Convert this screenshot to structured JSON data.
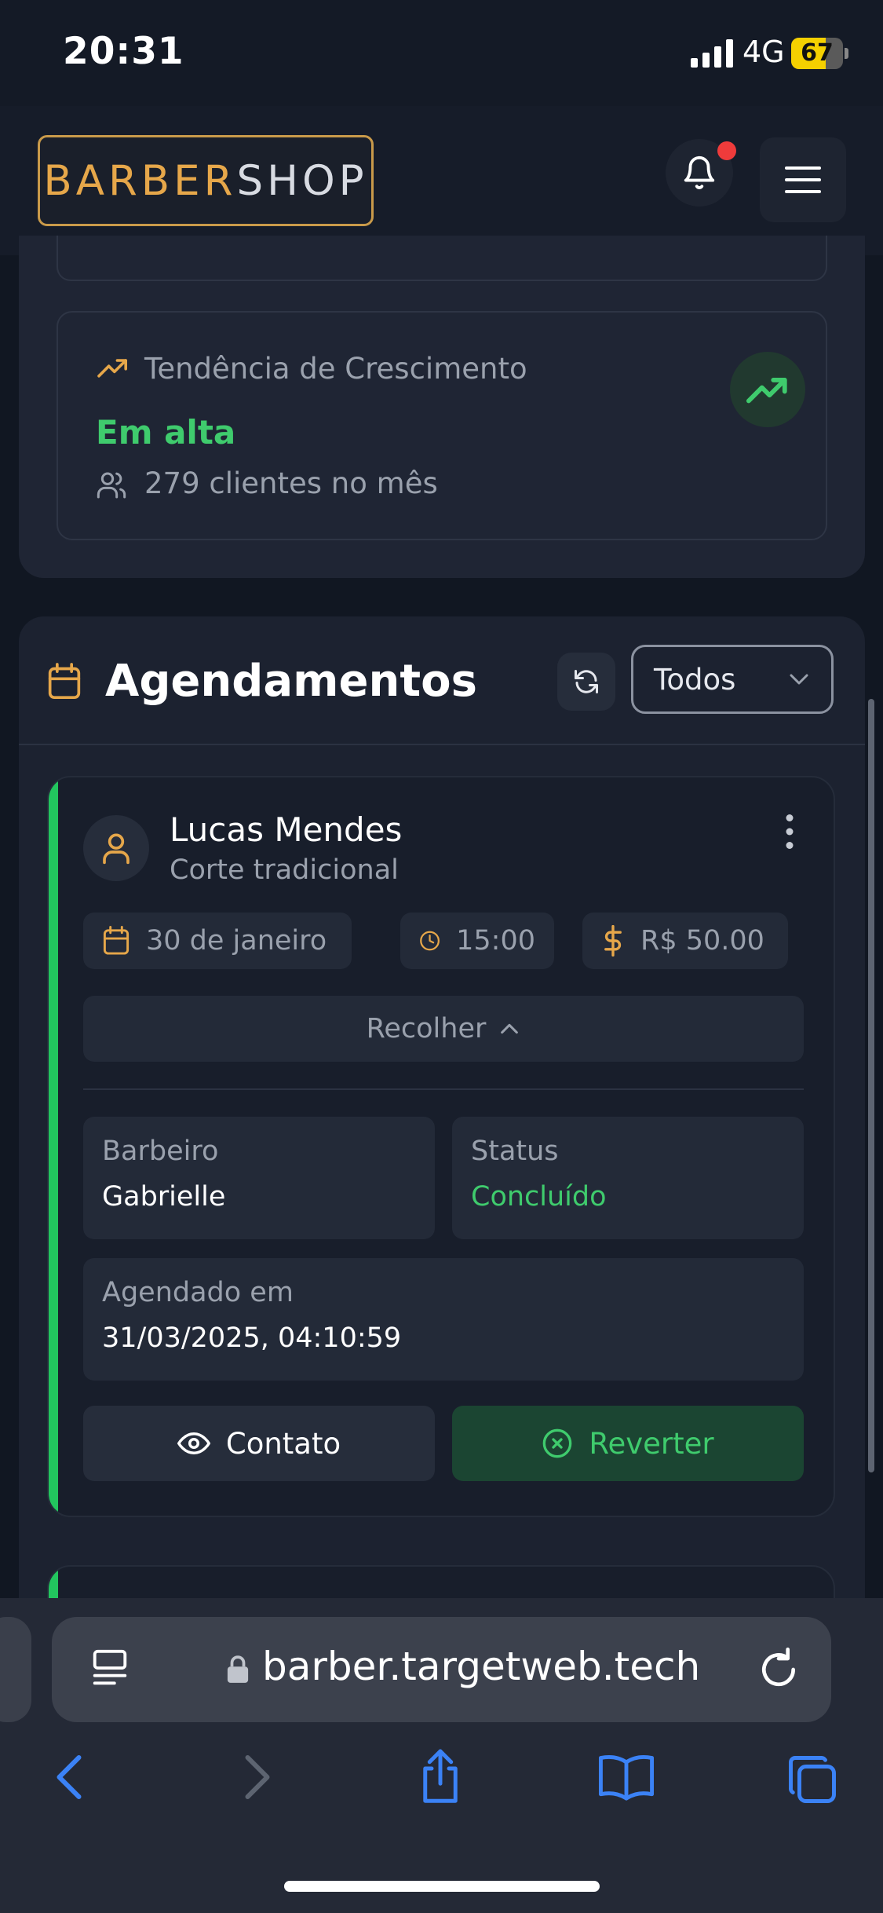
{
  "status_bar": {
    "time": "20:31",
    "network": "4G",
    "battery_percent": 67,
    "battery_label": "67"
  },
  "header": {
    "logo_part1": "BARBER",
    "logo_part2": "SHOP",
    "has_notification": true
  },
  "trend": {
    "title": "Tendência de Crescimento",
    "status": "Em alta",
    "clients_text": "279 clientes no mês"
  },
  "appointments": {
    "title": "Agendamentos",
    "filter_value": "Todos",
    "items": [
      {
        "client_name": "Lucas Mendes",
        "service": "Corte tradicional",
        "date": "30 de janeiro",
        "time": "15:00",
        "price": "R$ 50.00",
        "collapse_label": "Recolher",
        "barber_label": "Barbeiro",
        "barber": "Gabrielle",
        "status_label": "Status",
        "status": "Concluído",
        "scheduled_label": "Agendado em",
        "scheduled_at": "31/03/2025, 04:10:59",
        "contact_label": "Contato",
        "revert_label": "Reverter"
      }
    ]
  },
  "browser": {
    "url": "barber.targetweb.tech"
  },
  "colors": {
    "accent_gold": "#e6a74a",
    "success_green": "#3fcb6d",
    "card_accent": "#22c55e",
    "notification_red": "#ef3b3b",
    "safari_blue": "#3b82f6"
  }
}
